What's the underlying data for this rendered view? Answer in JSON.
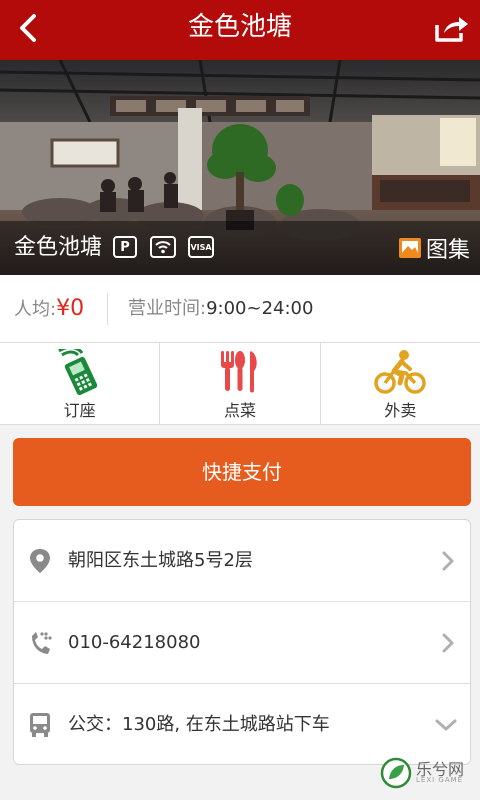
{
  "header": {
    "title": "金色池塘",
    "back_icon": "back-arrow-icon",
    "share_icon": "share-icon"
  },
  "hero": {
    "name": "金色池塘",
    "features": [
      "P",
      "wifi",
      "VISA"
    ],
    "gallery_label": "图集"
  },
  "info": {
    "avg_label": "人均:",
    "avg_price": "¥0",
    "hours_label": "营业时间:",
    "hours_value": "9:00~24:00"
  },
  "actions": [
    {
      "label": "订座",
      "icon": "phone-icon"
    },
    {
      "label": "点菜",
      "icon": "cutlery-icon"
    },
    {
      "label": "外卖",
      "icon": "bicycle-icon"
    }
  ],
  "pay_button": "快捷支付",
  "details": [
    {
      "text": "朝阳区东土城路5号2层",
      "icon": "location-icon",
      "indicator": "chevron-right-icon"
    },
    {
      "text": "010-64218080",
      "icon": "phone-call-icon",
      "indicator": "chevron-right-icon"
    },
    {
      "text": "公交：130路, 在东土城路站下车",
      "icon": "bus-icon",
      "indicator": "chevron-down-icon"
    }
  ],
  "watermark": {
    "text": "乐兮网",
    "sub": "LEXI GAME"
  },
  "colors": {
    "header": "#b30a0a",
    "pay": "#e65c1f",
    "price": "#e0251f",
    "phone": "#1a8a3a",
    "cutlery": "#e84a4a",
    "bike": "#e2a320"
  }
}
